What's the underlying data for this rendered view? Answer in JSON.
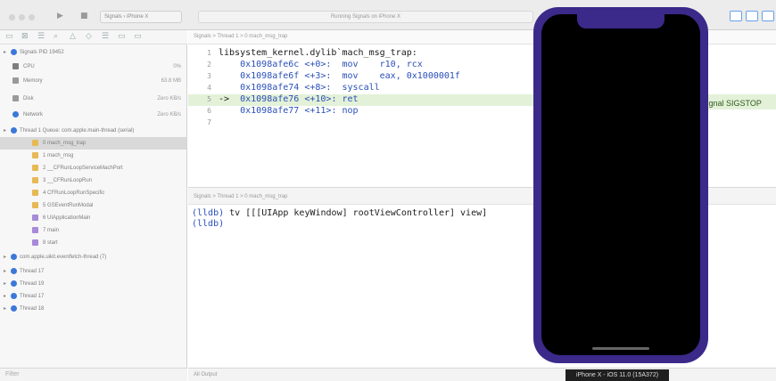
{
  "toolbar": {
    "scheme_target": "Signals",
    "device": "iPhone X",
    "status": "Running Signals on iPhone X"
  },
  "navigator": {
    "rows": [
      {
        "label": "Signals  PID 19452",
        "value": ""
      },
      {
        "label": "CPU",
        "value": "0%"
      },
      {
        "label": "Memory",
        "value": "63.8 MB"
      },
      {
        "label": "Disk",
        "value": "Zero KB/s"
      },
      {
        "label": "Network",
        "value": "Zero KB/s"
      },
      {
        "label": "Thread 1 Queue: com.apple.main-thread (serial)",
        "value": ""
      },
      {
        "label": "0 mach_msg_trap",
        "value": ""
      },
      {
        "label": "1 mach_msg",
        "value": ""
      },
      {
        "label": "2 __CFRunLoopServiceMachPort",
        "value": ""
      },
      {
        "label": "3 __CFRunLoopRun",
        "value": ""
      },
      {
        "label": "4 CFRunLoopRunSpecific",
        "value": ""
      },
      {
        "label": "5 GSEventRunModal",
        "value": ""
      },
      {
        "label": "6 UIApplicationMain",
        "value": ""
      },
      {
        "label": "7 main",
        "value": ""
      },
      {
        "label": "8 start",
        "value": ""
      },
      {
        "label": "com.apple.uikit.eventfetch-thread (7)",
        "value": ""
      },
      {
        "label": "Thread 17",
        "value": ""
      },
      {
        "label": "Thread 19",
        "value": ""
      },
      {
        "label": "Thread 17",
        "value": ""
      },
      {
        "label": "Thread 18",
        "value": ""
      }
    ],
    "filter_placeholder": "Filter"
  },
  "jumpbar": {
    "text": "Signals  >  Thread 1  >  0 mach_msg_trap"
  },
  "editor": {
    "lines": [
      {
        "num": "1",
        "pre": "libsystem_kernel.dylib`mach_msg_trap:",
        "addr": "",
        "post": ""
      },
      {
        "num": "2",
        "pre": "    ",
        "addr": "0x1098afe6c",
        "post": " <+0>:  mov    r10, rcx"
      },
      {
        "num": "3",
        "pre": "    ",
        "addr": "0x1098afe6f",
        "post": " <+3>:  mov    eax, 0x1000001f"
      },
      {
        "num": "4",
        "pre": "    ",
        "addr": "0x1098afe74",
        "post": " <+8>:  syscall"
      },
      {
        "num": "5",
        "pre": "->  ",
        "addr": "0x1098afe76",
        "post": " <+10>: ret"
      },
      {
        "num": "6",
        "pre": "    ",
        "addr": "0x1098afe77",
        "post": " <+11>: nop"
      },
      {
        "num": "7",
        "pre": "",
        "addr": "",
        "post": ""
      }
    ],
    "highlight_line": 5,
    "signal_badge": "signal SIGSTOP"
  },
  "debug": {
    "bar_text": "Signals  >  Thread 1  >  0 mach_msg_trap"
  },
  "console": {
    "prompt": "(lldb)",
    "command": "tv [[[UIApp keyWindow] rootViewController] view]",
    "second_prompt": "(lldb)",
    "output_mode": "All Output"
  },
  "simulator": {
    "label": "iPhone X - iOS 11.0 (15A372)",
    "frame_color": "#3b2a8a"
  },
  "colors": {
    "address": "#2a4fb8",
    "highlight": "#e3f1d8",
    "accent": "#3b78d8"
  }
}
